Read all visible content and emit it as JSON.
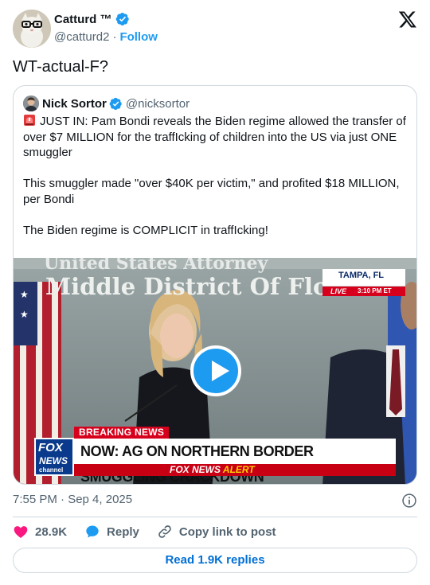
{
  "author": {
    "name": "Catturd ™",
    "handle": "@catturd2",
    "follow_label": "Follow",
    "separator": "·",
    "verified": true
  },
  "tweet": {
    "text": "WT-actual-F?"
  },
  "quoted": {
    "name": "Nick Sortor",
    "handle": "@nicksortor",
    "verified": true,
    "paragraphs": [
      "JUST IN: Pam Bondi reveals the Biden regime allowed the transfer of over $7 MILLION for the traffIcking of children into the US via just ONE smuggler",
      "This smuggler made \"over $40K per victim,\" and profited $18 MILLION, per Bondi",
      "The Biden regime is COMPLICIT in traffIcking!"
    ],
    "video": {
      "backdrop_text": "Middle District Of Florida",
      "location": "TAMPA, FL",
      "live_label": "LIVE",
      "time_label": "3:10 PM ET",
      "breaking_label": "BREAKING NEWS",
      "headline": "NOW: AG ON NORTHERN BORDER SMUGGLING CRACKDOWN",
      "alert_fox": "FOX NEWS",
      "alert_word": "ALERT",
      "logo_line1": "FOX",
      "logo_line2": "NEWS",
      "logo_line3": "channel"
    }
  },
  "meta": {
    "timestamp": "7:55 PM · Sep 4, 2025"
  },
  "actions": {
    "likes": "28.9K",
    "reply_label": "Reply",
    "copy_label": "Copy link to post"
  },
  "read_replies_label": "Read 1.9K replies",
  "colors": {
    "accent": "#1d9bf0",
    "like": "#f91880",
    "secondary_text": "#536471",
    "border": "#cfd9de",
    "fox_red": "#d6001c"
  }
}
